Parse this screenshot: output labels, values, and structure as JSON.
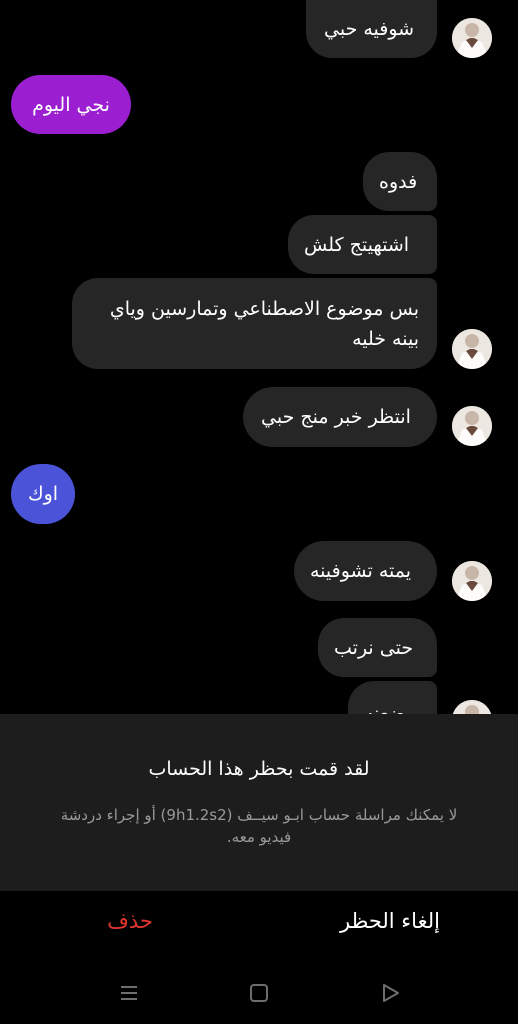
{
  "messages": [
    {
      "text": "شوفيه حبي"
    },
    {
      "text": "نجي اليوم"
    },
    {
      "text": "فدوه"
    },
    {
      "text": "اشتهيتج كلش"
    },
    {
      "text": "بس موضوع الاصطناعي وتمارسين وياي بينه خليه"
    },
    {
      "text": "انتظر خبر منج حبي"
    },
    {
      "text": "اوك"
    },
    {
      "text": "يمته تشوفينه"
    },
    {
      "text": "حتى نرتب"
    },
    {
      "text": "وضعنه"
    }
  ],
  "blocked": {
    "title": "لقد قمت بحظر هذا الحساب",
    "description": "لا يمكنك مراسلة حساب ابـو  سيــف (9h1.2s2) أو إجراء دردشة فيديو معه."
  },
  "actions": {
    "unblock_label": "إلغاء الحظر",
    "delete_label": "حذف"
  },
  "navbar": {
    "icons": [
      "menu-icon",
      "home-square-icon",
      "back-triangle-icon"
    ]
  },
  "colors": {
    "incoming_bubble": "#262626",
    "outgoing_purple": "#9b1fd0",
    "outgoing_blue": "#4b54d8",
    "delete_red": "#e0352f",
    "panel_bg": "#1d1d1d"
  }
}
